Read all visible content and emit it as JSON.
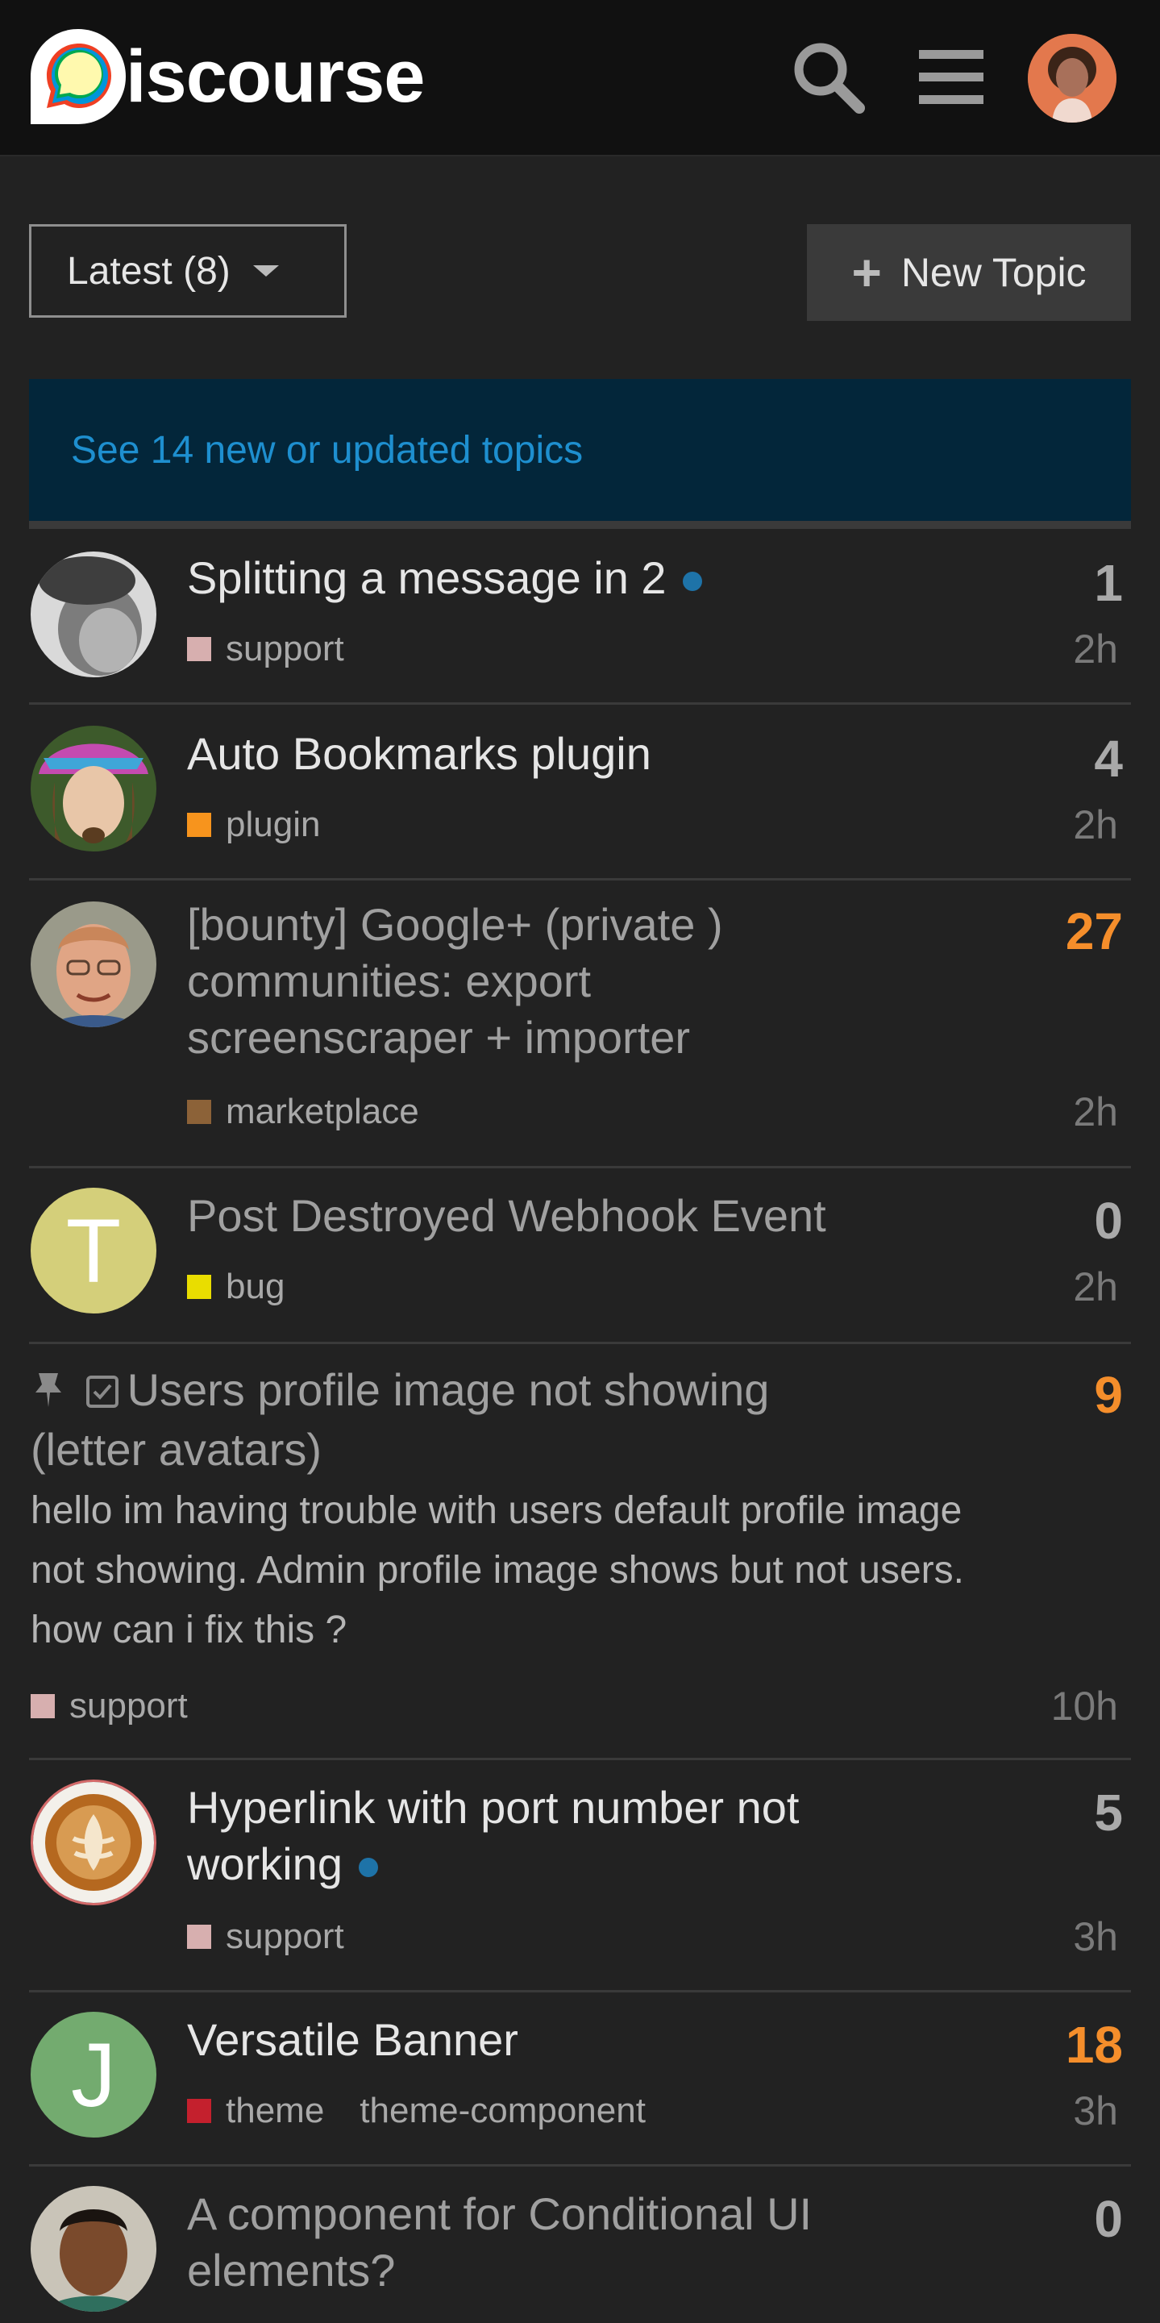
{
  "header": {
    "logo_text": "iscourse",
    "brand_colors": {
      "yellow": "#fff9ae",
      "green": "#00a94f",
      "blue": "#0095da",
      "red": "#ef3f23"
    }
  },
  "controls": {
    "filter_label": "Latest (8)",
    "new_topic_label": "New Topic"
  },
  "alert": {
    "text": "See 14 new or updated topics"
  },
  "topics": [
    {
      "title": "Splitting a message in 2",
      "category": "support",
      "cat_color": "#d7afaf",
      "replies": "1",
      "age": "2h",
      "unread": true,
      "visited": false
    },
    {
      "title": "Auto Bookmarks plugin",
      "category": "plugin",
      "cat_color": "#f7941d",
      "replies": "4",
      "age": "2h",
      "unread": false,
      "visited": false
    },
    {
      "title_lines": [
        "[bounty] Google+ (private )",
        "communities: export",
        "screenscraper + importer"
      ],
      "category": "marketplace",
      "cat_color": "#8c6238",
      "replies": "27",
      "age": "2h",
      "hot": true,
      "visited": true
    },
    {
      "title": "Post Destroyed Webhook Event",
      "category": "bug",
      "cat_color": "#e9dd00",
      "replies": "0",
      "age": "2h",
      "avatar_letter": "T",
      "visited": true
    },
    {
      "title_lines": [
        "Users profile image not showing",
        "(letter avatars)"
      ],
      "excerpt_lines": [
        "hello im having trouble with users default profile image",
        "not showing. Admin profile image shows but not users.",
        "how can i fix this ?"
      ],
      "category": "support",
      "cat_color": "#d7afaf",
      "replies": "9",
      "age": "10h",
      "hot": true,
      "pinned": true,
      "visited": true
    },
    {
      "title_lines": [
        "Hyperlink with port number not",
        "working"
      ],
      "category": "support",
      "cat_color": "#d7afaf",
      "replies": "5",
      "age": "3h",
      "unread": true
    },
    {
      "title": "Versatile Banner",
      "category": "theme",
      "cat_color": "#c4202d",
      "tag": "theme-component",
      "replies": "18",
      "age": "3h",
      "hot": true,
      "avatar_letter": "J"
    },
    {
      "title_lines": [
        "A component for Conditional UI",
        "elements?"
      ],
      "replies": "0",
      "visited": true
    }
  ]
}
